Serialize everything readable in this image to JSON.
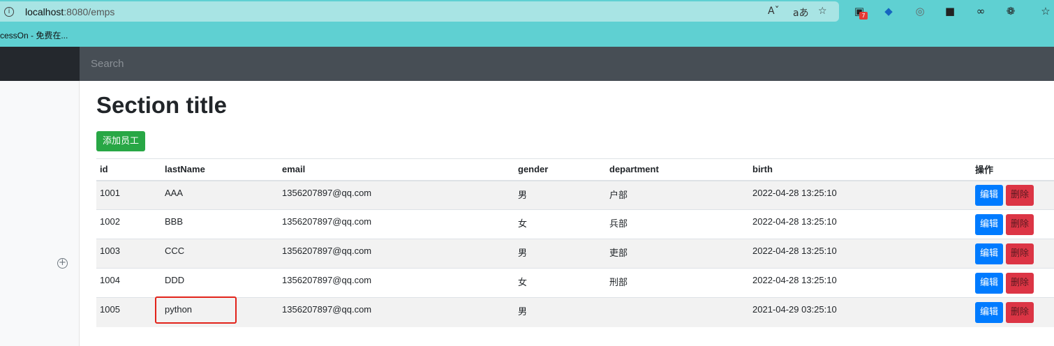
{
  "browser": {
    "url_host": "localhost",
    "url_rest": ":8080/emps",
    "bookmark": "cessOn - 免费在...",
    "extension_badge": "7"
  },
  "navbar": {
    "search_placeholder": "Search"
  },
  "main": {
    "title": "Section title",
    "add_button": "添加员工",
    "columns": [
      "id",
      "lastName",
      "email",
      "gender",
      "department",
      "birth",
      "操作"
    ],
    "rows": [
      {
        "id": "1001",
        "lastName": "AAA",
        "email": "1356207897@qq.com",
        "gender": "男",
        "department": "户部",
        "birth": "2022-04-28 13:25:10"
      },
      {
        "id": "1002",
        "lastName": "BBB",
        "email": "1356207897@qq.com",
        "gender": "女",
        "department": "兵部",
        "birth": "2022-04-28 13:25:10"
      },
      {
        "id": "1003",
        "lastName": "CCC",
        "email": "1356207897@qq.com",
        "gender": "男",
        "department": "吏部",
        "birth": "2022-04-28 13:25:10"
      },
      {
        "id": "1004",
        "lastName": "DDD",
        "email": "1356207897@qq.com",
        "gender": "女",
        "department": "刑部",
        "birth": "2022-04-28 13:25:10"
      },
      {
        "id": "1005",
        "lastName": "python",
        "email": "1356207897@qq.com",
        "gender": "男",
        "department": "",
        "birth": "2021-04-29 03:25:10"
      }
    ],
    "edit_label": "编辑",
    "delete_label": "删除"
  },
  "colors": {
    "add": "#28a745",
    "edit": "#007bff",
    "delete": "#dc3545",
    "highlight": "#e2231a"
  }
}
